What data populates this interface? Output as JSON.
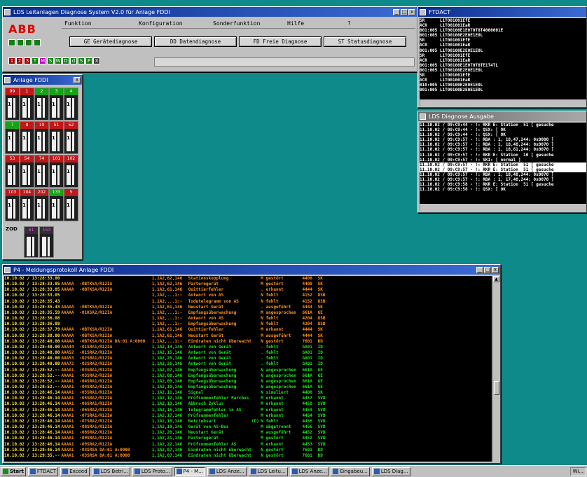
{
  "main_window": {
    "title": "LDS Leitanlagen Diagnose System  V2.0  für Anlage FDDI",
    "logo": "ABB",
    "menu": [
      "Funktion",
      "Konfiguration",
      "Sonderfunktion",
      "Hilfe",
      "?"
    ],
    "diag_buttons": [
      "GE Gerätediagnose",
      "DD Datendiagnose",
      "FD Freie Diagnose",
      "ST Statusdiagnose"
    ],
    "status_boxes": [
      "1",
      "2",
      "3",
      "T",
      "M",
      "S",
      "W",
      "D",
      "d",
      "S",
      "P",
      "X"
    ]
  },
  "anlage_window": {
    "title": "Anlage FDDI",
    "rows": [
      [
        "99",
        "1",
        "2",
        "3",
        "4"
      ],
      [
        "7",
        "8",
        "10",
        "51",
        "52"
      ],
      [
        "53",
        "54",
        "74",
        "101",
        "102"
      ],
      [
        "103",
        "104",
        "202",
        "133",
        "5"
      ]
    ],
    "numbers": [
      [
        "1",
        "1",
        "1",
        "1",
        "1"
      ],
      [
        "1",
        "1",
        "1",
        "1",
        "1"
      ],
      [
        "1",
        "1",
        "1",
        "1",
        "1"
      ],
      [
        "1",
        "1",
        "1",
        "1",
        "1"
      ]
    ],
    "bottom_label": "ZOD",
    "bottom_cells": [
      "61",
      "153"
    ]
  },
  "ftdacs_window": {
    "title": "FTDACT",
    "lines": [
      "SR      L1T001001EfE",
      "ACR     L1T001001EaR",
      "001:005 L1T00100E1E0T0T0T4000001E",
      "001:005 L1T00100E2E0E1E0L",
      "SR      L1T001001EfE",
      "ACR     L1T001001EaR",
      "001:005 L1T00100E2E0E1E0L",
      "SR      L1T001001EfE",
      "ACR     L1T001001EaR",
      "001:005 L1T00100E1E0T0T0TE1T4TL",
      "001:005 L1T00100E2E0E1E0L",
      "SR      L1T001001EfE",
      "ACR     L1T001001EaR",
      "010:005 L1T00100E2E0E1E0L",
      "001:005 L1T00100E2E0E1E0L"
    ]
  },
  "ausgabe_window": {
    "title": "LDS Diagnose Ausgabe",
    "lines": [
      "11.10.02 / 09:C9:44 - !: RKR E: Station  51 [ gesuche",
      "11.10.02 / 09:C9:44 - !: QSX: [ OK",
      "11.10.02 / 09:C9:44 - !: QSX: [ OK",
      "11.10.02 / 09:C9:57 - !: RBA : 1, 18,47,244: 0x0000 ]",
      "11.10.02 / 09:C9:57 - !: RBA : 1, 18,48,244: 0x0070 ]",
      "11.10.02 / 09:C9:57 - !: RBA : 1, 18,61,244: 0x0070 ]",
      "11.10.02 / 09:C9:57 - !: RKR E: Station  10 [ gesuche",
      "11.10.02 / 09:C9:57 - !: SKI: [ normal ]",
      "11.10.02 / 09:C9:57 - !: RKR E: Station  51 [ gesuche",
      "11.10.02 / 09:C9:57 - !: RKR E: Station  51 [ gesuche",
      "11.10.02 / 09:C9:57 - !: RBA : 1, 18,48,244: 0x0070 ]",
      "11.10.02 / 09:C9:57 - !: RBA : 1, 17,48,244: 0x0070 ]",
      "11.10.02 / 09:C9:58 - !: RKR E: Station  51 [ gesuche",
      "11.10.02 / 09:C9:58 - !: QSX: [ OK"
    ]
  },
  "protokoll_window": {
    "title": "P4 - Meldungsprotokoll Anlage FDDI",
    "rows": [
      [
        "10.10.02 / 13:28:33.00",
        "",
        "",
        "1,1A2,62,146",
        "Stationskopplung",
        "M gestört",
        "4400",
        "SK"
      ],
      [
        "10.10.02 / 13:28:33.05",
        "AAAAA",
        "-OBTKSA/R12IA",
        "1,1A2,62,146",
        "Parteregerät",
        "M gestört",
        "4400",
        "SK"
      ],
      [
        "10.10.02 / 13:28:33.05",
        "AAAAA",
        "-OBTKSA/R12IA",
        "1,1A2,61,146",
        "Quittierfehler",
        ". erkannt",
        "4444",
        "SK"
      ],
      [
        "10.10.02 / 13:28:33.05",
        "",
        "",
        "1,1A2,...1:-",
        "Antwort von AS",
        "N fehlt",
        "4152",
        "USB"
      ],
      [
        "10.10.02 / 13:28:35.43",
        "",
        "",
        "1,1A2,...1:-",
        "Todetelegramm von AS",
        "N fehlt",
        "4152",
        "USB"
      ],
      [
        "10.10.02 / 13:28:35.43",
        "AAAAA",
        "-OBTKSA/R12IA",
        "1,1A2,61,146",
        "Neustart Gerät",
        ". ausgeführt",
        "4444",
        "SK"
      ],
      [
        "10.10.02 / 13:28:35.59",
        "AAAAA",
        "-O1KSA2/R12IA",
        "1,1A2,...1:-",
        "Empfangsüberwachung",
        "M angesprochen",
        "661A",
        "GE"
      ],
      [
        "10.10.02 / 13:28:36.08",
        "",
        "",
        "1,1A2,...1:-",
        "Antwort von AS",
        "N fehlt",
        "4204",
        "USB"
      ],
      [
        "10.10.02 / 13:28:36.08",
        "",
        "",
        "1,1A2,...1:-",
        "Empfangsüberwachung",
        "N fehlt",
        "4204",
        "USB"
      ],
      [
        "10.10.02 / 13:28:37.79",
        "AAAAA",
        "-OBTKSA/R12IA",
        "1,1A2,61,146",
        "Quittierfehler",
        "M erkannt",
        "4444",
        "SK"
      ],
      [
        "10.10.02 / 13:28:38.00",
        "AAAAA",
        "-OBTKSA/R12IA",
        "1,1A2,61,146",
        "Neustart Gerät",
        "M ausgeführt",
        "4444",
        "SK"
      ],
      [
        "10.10.02 / 13:28:40.00",
        "AAAAA",
        "-OBTKSA/R12IA DA:01 A:0000",
        "1,1A2,...1:-",
        "Eindraten nicht überwacht",
        "N gestört",
        "7601",
        "DD"
      ],
      [
        "10.10.02 / 13:28:40.00",
        "AAA44",
        "-O1SRA1/R12IA",
        "1,1A2,14,146",
        "Antwort von Gerät",
        ". fehlt",
        "GA01",
        "ID"
      ],
      [
        "10.10.02 / 13:28:40.00",
        "AAA52",
        "-O1SRA2/R12IA",
        "1,1A2,15,146",
        "Antwort von Gerät",
        ". fehlt",
        "GA01",
        "ID"
      ],
      [
        "10.10.02 / 13:28:40.00",
        "AAA53",
        "-O2SRA1/R12IA",
        "1,1A2,25,146",
        "Antwort von Gerät",
        ". fehlt",
        "GA01",
        "ID"
      ],
      [
        "10.10.02 / 13:28:40.00",
        "AAA72",
        "-O2SRA2/R12IA",
        "1,1A2,26,146",
        "Antwort von Gerät",
        ". fehlt",
        "GA01",
        "ID"
      ],
      [
        "10.10.02 / 13:28:52.--",
        "AAAA1",
        "-O3SRA1/R12IA",
        "1,1A2,07,146",
        "Empfangsüberwachung",
        "N angesprochen",
        "661A",
        "GE"
      ],
      [
        "10.10.02 / 13:28:52.--",
        "AAAA1",
        "-O3SRA2/R12IA",
        "1,1A2,08,146",
        "Empfangsüberwachung",
        "N angesprochen",
        "661A",
        "GE"
      ],
      [
        "10.10.02 / 13:28:52.--",
        "AAAA1",
        "-O4SRA1/R12IA",
        "1,1A2,09,146",
        "Empfangsüberwachung",
        "N angesprochen",
        "661A",
        "GE"
      ],
      [
        "10.10.02 / 13:28:52.--",
        "AAAA1",
        "-O4SRA2/R12IA",
        "1,1A2,10,146",
        "Empfangsüberwachung",
        "N angesprochen",
        "661A",
        "GE"
      ],
      [
        "10.10.02 / 13:28:46.14",
        "AAAA1",
        "-O5SRA1/R12IA",
        "1,1A2,11,146",
        "Signal",
        "N simuliert",
        "4400",
        "SK"
      ],
      [
        "10.10.02 / 13:28:46.14",
        "AAAA1",
        "-O5SRA2/R12IA",
        "1,1A2,12,146",
        "Prüfsummenfehler Parcbus",
        "M erkannt",
        "4457",
        "SVD"
      ],
      [
        "10.10.02 / 13:28:46.14",
        "AAAA1",
        "-O6SRA1/R12IA",
        "1,1A2,13,146",
        "Abbruch Zyklus",
        "M erkannt",
        "4458",
        "SVD"
      ],
      [
        "10.10.02 / 13:28:46.14",
        "AAAA1",
        "-O6SRA2/R12IA",
        "1,1A2,16,146",
        "Telegrammfehler in AS",
        "M erkannt",
        "4459",
        "SVD"
      ],
      [
        "10.10.02 / 13:28:46.14",
        "AAAA1",
        "-O7SRA1/R12IA",
        "1,1A2,17,146",
        "Prüfsummenfehler",
        "M erkannt",
        "4454",
        "SVD"
      ],
      [
        "10.10.02 / 13:28:46.14",
        "AAAA1",
        "-O7SRA2/R12IA",
        "1,1A2,18,146",
        "Betriebsart              (D)",
        "N fehlt",
        "4456",
        "SVD"
      ],
      [
        "10.10.02 / 13:28:46.14",
        "AAAA1",
        "-O8SRA1/R12IA",
        "1,1A2,19,146",
        "Gerät von AS-Bus",
        "M abgetrennt",
        "4456",
        "SVD"
      ],
      [
        "10.10.02 / 13:28:46.14",
        "AAAA1",
        "-O8SRA2/R12IA",
        "1,1A2,20,146",
        "Neustart Gerät",
        "M ausgeführt",
        "4452",
        "SVD"
      ],
      [
        "10.10.02 / 13:28:46.14",
        "AAAA1",
        "-O9SRA1/R12IA",
        "1,1A2,21,146",
        "Parteregerät",
        "M gestört",
        "4452",
        "SVD"
      ],
      [
        "10.10.02 / 13:28:46.14",
        "AAAA1",
        "-O9SRA2/R12IA",
        "1,1A2,22,146",
        "Prüfsummenfehler AS",
        "M erkannt",
        "4453",
        "SVD"
      ],
      [
        "10.10.02 / 13:28:46.14",
        "AAAA1",
        "-O3SRSA DA:01 A:0000",
        "1,1A2,07,146",
        "Eindraten nicht überwacht",
        "N gestört",
        "7601",
        "DD"
      ],
      [
        "10.10.02 / 13:29:35.--",
        "AAAA1",
        "-O3SRSA DA:01 A:0000",
        "1,1A2,07,146",
        "Eindraten nicht überwacht",
        "N gestört",
        "7601",
        "DD"
      ]
    ]
  },
  "taskbar": {
    "start": "Start",
    "items": [
      "FTDACT",
      "Exceed",
      "LDS Betri...",
      "LDS Proto...",
      "P4 - M...",
      "LDS Anze...",
      "LDS Leitu...",
      "LDS Anze...",
      "Eingabeu...",
      "LDS Diag..."
    ],
    "clock": "Wi..."
  }
}
